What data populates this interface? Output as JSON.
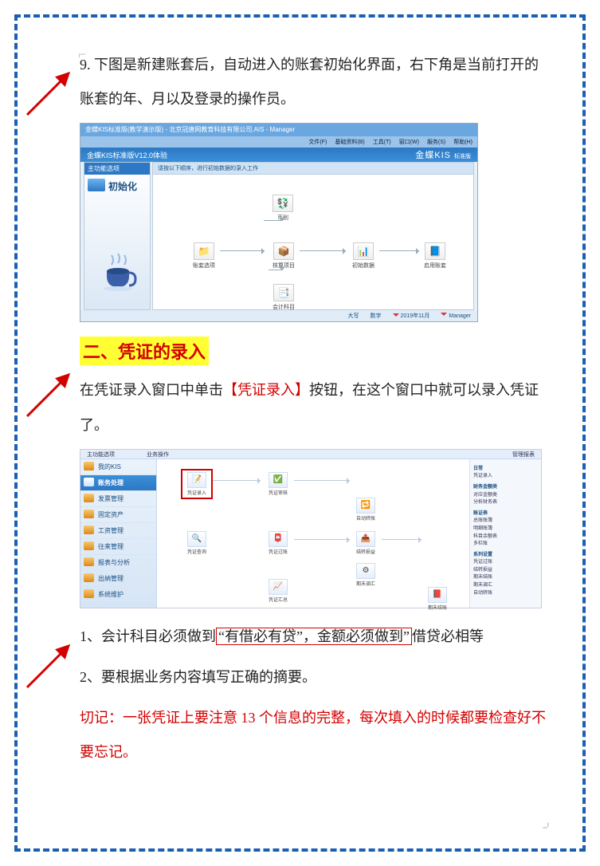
{
  "para1": "9. 下图是新建账套后，自动进入的账套初始化界面，右下角是当前打开的账套的年、月以及登录的操作员。",
  "section2_title": "二、凭证的录入",
  "para2_a": "在凭证录入窗口中单击",
  "para2_b": "【凭证录入】",
  "para2_c": "按钮，在这个窗口中就可以录入凭证了。",
  "rule1_a": "1、会计科目必须做到",
  "rule1_b": "“有借必有贷”，金额必须做到”",
  "rule1_c": "借贷必相等",
  "rule2": "2、要根据业务内容填写正确的摘要。",
  "note": "切记：一张凭证上要注意 13 个信息的完整，每次填入的时候都要检查好不要忘记。",
  "ss1": {
    "titlebar": "金蝶KIS标准版(教学演示版) - 北京冠唐网教育科技有限公司.AIS - Manager",
    "menu": [
      "文件(F)",
      "基础资料(B)",
      "工具(T)",
      "窗口(W)",
      "服务(S)",
      "帮助(H)"
    ],
    "brand_left": "金蝶KIS标准版V12.0体验",
    "brand_right": "金蝶KIS",
    "brand_ver": "标准版",
    "sidebar_head": "主功能选项",
    "init": "初始化",
    "main_head": "请按以下顺序，进行初始数据的录入工作",
    "nodes": {
      "bz": "币别",
      "zt": "账套选项",
      "hs": "核算项目",
      "cs": "初始数据",
      "qm": "启用账套",
      "kj": "会计科目"
    },
    "status": {
      "a": "大写",
      "b": "数字",
      "date": "2019年11月",
      "user": "Manager"
    }
  },
  "ss2": {
    "tabs": [
      "主功能选项",
      "业务操作",
      "管理报表"
    ],
    "sidebar": [
      "我的KIS",
      "账务处理",
      "发票管理",
      "固定资产",
      "工资管理",
      "往来管理",
      "报表与分析",
      "出纳管理",
      "系统维护"
    ],
    "nodes": {
      "pzlr": "凭证录入",
      "pzsh": "凭证审核",
      "pzcx": "凭证查询",
      "pzgz": "凭证过账",
      "pzhz": "凭证汇总",
      "zyzz": "自动转账",
      "jzsy": "结转损益",
      "qmjz": "期末结账",
      "qmtz": "期末调汇"
    },
    "right": {
      "h1": "日常",
      "i1": "凭证录入",
      "h2": "财务金额类",
      "i2": "对应金额类",
      "i3": "分析财务表",
      "h3": "账证表",
      "i4": "总账账簿",
      "i5": "明细账簿",
      "i6": "科目余额表",
      "i7": "多栏账",
      "h4": "系列设置",
      "i8": "凭证过账",
      "i9": "结转损益",
      "i10": "期末结账",
      "i11": "期末调汇",
      "i12": "自动转账"
    }
  }
}
